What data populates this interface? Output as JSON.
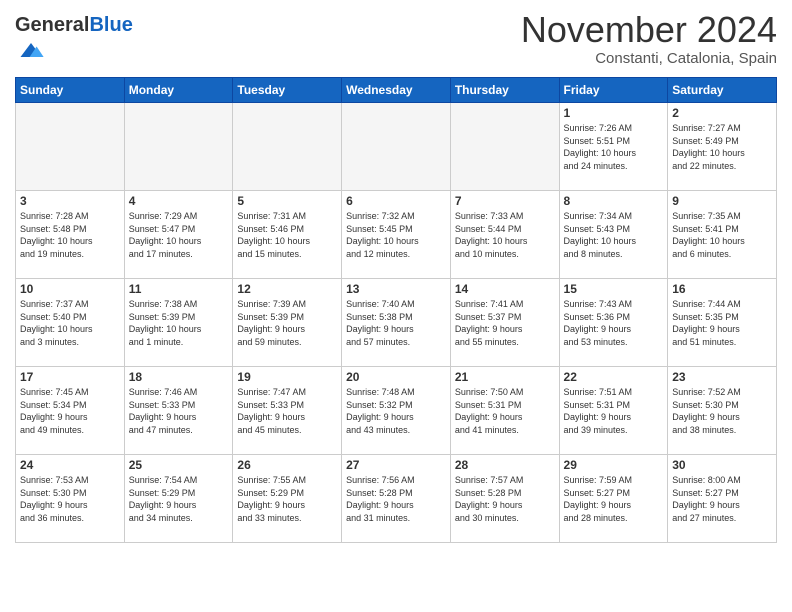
{
  "header": {
    "logo_general": "General",
    "logo_blue": "Blue",
    "month_title": "November 2024",
    "location": "Constanti, Catalonia, Spain"
  },
  "days_of_week": [
    "Sunday",
    "Monday",
    "Tuesday",
    "Wednesday",
    "Thursday",
    "Friday",
    "Saturday"
  ],
  "weeks": [
    {
      "stripe": false,
      "days": [
        {
          "num": "",
          "info": "",
          "empty": true
        },
        {
          "num": "",
          "info": "",
          "empty": true
        },
        {
          "num": "",
          "info": "",
          "empty": true
        },
        {
          "num": "",
          "info": "",
          "empty": true
        },
        {
          "num": "",
          "info": "",
          "empty": true
        },
        {
          "num": "1",
          "info": "Sunrise: 7:26 AM\nSunset: 5:51 PM\nDaylight: 10 hours\nand 24 minutes.",
          "empty": false
        },
        {
          "num": "2",
          "info": "Sunrise: 7:27 AM\nSunset: 5:49 PM\nDaylight: 10 hours\nand 22 minutes.",
          "empty": false
        }
      ]
    },
    {
      "stripe": true,
      "days": [
        {
          "num": "3",
          "info": "Sunrise: 7:28 AM\nSunset: 5:48 PM\nDaylight: 10 hours\nand 19 minutes.",
          "empty": false
        },
        {
          "num": "4",
          "info": "Sunrise: 7:29 AM\nSunset: 5:47 PM\nDaylight: 10 hours\nand 17 minutes.",
          "empty": false
        },
        {
          "num": "5",
          "info": "Sunrise: 7:31 AM\nSunset: 5:46 PM\nDaylight: 10 hours\nand 15 minutes.",
          "empty": false
        },
        {
          "num": "6",
          "info": "Sunrise: 7:32 AM\nSunset: 5:45 PM\nDaylight: 10 hours\nand 12 minutes.",
          "empty": false
        },
        {
          "num": "7",
          "info": "Sunrise: 7:33 AM\nSunset: 5:44 PM\nDaylight: 10 hours\nand 10 minutes.",
          "empty": false
        },
        {
          "num": "8",
          "info": "Sunrise: 7:34 AM\nSunset: 5:43 PM\nDaylight: 10 hours\nand 8 minutes.",
          "empty": false
        },
        {
          "num": "9",
          "info": "Sunrise: 7:35 AM\nSunset: 5:41 PM\nDaylight: 10 hours\nand 6 minutes.",
          "empty": false
        }
      ]
    },
    {
      "stripe": false,
      "days": [
        {
          "num": "10",
          "info": "Sunrise: 7:37 AM\nSunset: 5:40 PM\nDaylight: 10 hours\nand 3 minutes.",
          "empty": false
        },
        {
          "num": "11",
          "info": "Sunrise: 7:38 AM\nSunset: 5:39 PM\nDaylight: 10 hours\nand 1 minute.",
          "empty": false
        },
        {
          "num": "12",
          "info": "Sunrise: 7:39 AM\nSunset: 5:39 PM\nDaylight: 9 hours\nand 59 minutes.",
          "empty": false
        },
        {
          "num": "13",
          "info": "Sunrise: 7:40 AM\nSunset: 5:38 PM\nDaylight: 9 hours\nand 57 minutes.",
          "empty": false
        },
        {
          "num": "14",
          "info": "Sunrise: 7:41 AM\nSunset: 5:37 PM\nDaylight: 9 hours\nand 55 minutes.",
          "empty": false
        },
        {
          "num": "15",
          "info": "Sunrise: 7:43 AM\nSunset: 5:36 PM\nDaylight: 9 hours\nand 53 minutes.",
          "empty": false
        },
        {
          "num": "16",
          "info": "Sunrise: 7:44 AM\nSunset: 5:35 PM\nDaylight: 9 hours\nand 51 minutes.",
          "empty": false
        }
      ]
    },
    {
      "stripe": true,
      "days": [
        {
          "num": "17",
          "info": "Sunrise: 7:45 AM\nSunset: 5:34 PM\nDaylight: 9 hours\nand 49 minutes.",
          "empty": false
        },
        {
          "num": "18",
          "info": "Sunrise: 7:46 AM\nSunset: 5:33 PM\nDaylight: 9 hours\nand 47 minutes.",
          "empty": false
        },
        {
          "num": "19",
          "info": "Sunrise: 7:47 AM\nSunset: 5:33 PM\nDaylight: 9 hours\nand 45 minutes.",
          "empty": false
        },
        {
          "num": "20",
          "info": "Sunrise: 7:48 AM\nSunset: 5:32 PM\nDaylight: 9 hours\nand 43 minutes.",
          "empty": false
        },
        {
          "num": "21",
          "info": "Sunrise: 7:50 AM\nSunset: 5:31 PM\nDaylight: 9 hours\nand 41 minutes.",
          "empty": false
        },
        {
          "num": "22",
          "info": "Sunrise: 7:51 AM\nSunset: 5:31 PM\nDaylight: 9 hours\nand 39 minutes.",
          "empty": false
        },
        {
          "num": "23",
          "info": "Sunrise: 7:52 AM\nSunset: 5:30 PM\nDaylight: 9 hours\nand 38 minutes.",
          "empty": false
        }
      ]
    },
    {
      "stripe": false,
      "days": [
        {
          "num": "24",
          "info": "Sunrise: 7:53 AM\nSunset: 5:30 PM\nDaylight: 9 hours\nand 36 minutes.",
          "empty": false
        },
        {
          "num": "25",
          "info": "Sunrise: 7:54 AM\nSunset: 5:29 PM\nDaylight: 9 hours\nand 34 minutes.",
          "empty": false
        },
        {
          "num": "26",
          "info": "Sunrise: 7:55 AM\nSunset: 5:29 PM\nDaylight: 9 hours\nand 33 minutes.",
          "empty": false
        },
        {
          "num": "27",
          "info": "Sunrise: 7:56 AM\nSunset: 5:28 PM\nDaylight: 9 hours\nand 31 minutes.",
          "empty": false
        },
        {
          "num": "28",
          "info": "Sunrise: 7:57 AM\nSunset: 5:28 PM\nDaylight: 9 hours\nand 30 minutes.",
          "empty": false
        },
        {
          "num": "29",
          "info": "Sunrise: 7:59 AM\nSunset: 5:27 PM\nDaylight: 9 hours\nand 28 minutes.",
          "empty": false
        },
        {
          "num": "30",
          "info": "Sunrise: 8:00 AM\nSunset: 5:27 PM\nDaylight: 9 hours\nand 27 minutes.",
          "empty": false
        }
      ]
    }
  ]
}
